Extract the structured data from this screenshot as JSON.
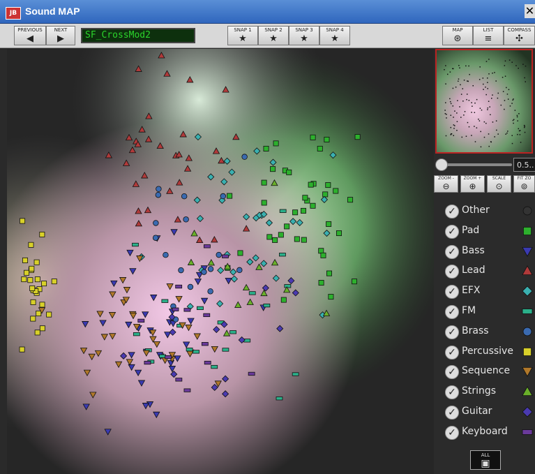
{
  "window": {
    "title": "Sound MAP",
    "icon_text": "JB",
    "close": "✕"
  },
  "toolbar": {
    "previous_label": "PREVIOUS",
    "next_label": "NEXT",
    "preset_name": "SF_CrossMod2",
    "snaps": [
      "SNAP 1",
      "SNAP 2",
      "SNAP 3",
      "SNAP 4"
    ],
    "map_label": "MAP",
    "list_label": "LIST",
    "compass_label": "COMPASS"
  },
  "zoom": {
    "value_text": "0.5..",
    "zoom_out": "ZOOM -",
    "zoom_in": "ZOOM +",
    "scale": "SCALE",
    "fit": "FIT ZO"
  },
  "categories": [
    {
      "name": "Other",
      "shape": "circle",
      "color": "#333333"
    },
    {
      "name": "Pad",
      "shape": "square",
      "color": "#2db02d"
    },
    {
      "name": "Bass",
      "shape": "tri-down",
      "color": "#3a3ab0"
    },
    {
      "name": "Lead",
      "shape": "tri-up",
      "color": "#b03a3a"
    },
    {
      "name": "EFX",
      "shape": "diamond",
      "color": "#3ab0b0"
    },
    {
      "name": "FM",
      "shape": "rect",
      "color": "#2bb08a"
    },
    {
      "name": "Brass",
      "shape": "circle",
      "color": "#3a6ab0"
    },
    {
      "name": "Percussive",
      "shape": "square",
      "color": "#d8d02a"
    },
    {
      "name": "Sequence",
      "shape": "tri-down",
      "color": "#b0782a"
    },
    {
      "name": "Strings",
      "shape": "tri-up",
      "color": "#6ab02a"
    },
    {
      "name": "Guitar",
      "shape": "diamond",
      "color": "#4a3ab0"
    },
    {
      "name": "Keyboard",
      "shape": "rect",
      "color": "#6a3a9a"
    }
  ],
  "all_label": "ALL",
  "colors": {
    "accent_red": "#c0272d",
    "lcd_green": "#2bd42b"
  }
}
